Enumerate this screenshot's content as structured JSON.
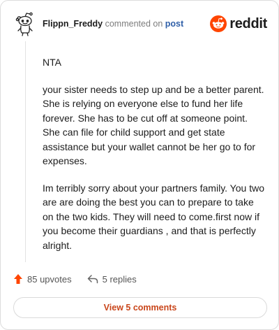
{
  "header": {
    "author": "Flippn_Freddy",
    "action": " commented on ",
    "post_link": "post",
    "brand": "reddit"
  },
  "comment": {
    "paragraphs": [
      "NTA",
      "your sister needs to step up and be a better parent. She is relying on everyone else to fund her life forever. She has to be cut off at someone point. She can file for child support and get state assistance but your wallet cannot be her go to for expenses.",
      "Im terribly sorry about your partners family. You two are are doing the best you can to prepare to take on the two kids. They will need to come.first now if you become their guardians , and that is perfectly alright."
    ]
  },
  "footer": {
    "upvotes": "85 upvotes",
    "replies": "5 replies",
    "view_button": "View 5 comments"
  },
  "colors": {
    "brand_orange": "#ff4500",
    "upvote": "#ff4500",
    "link_blue": "#2f5fa8",
    "view_button_text": "#c9461b"
  },
  "icons": [
    "snoo-avatar-icon",
    "reddit-logo-icon",
    "upvote-arrow-icon",
    "reply-arrow-icon"
  ]
}
